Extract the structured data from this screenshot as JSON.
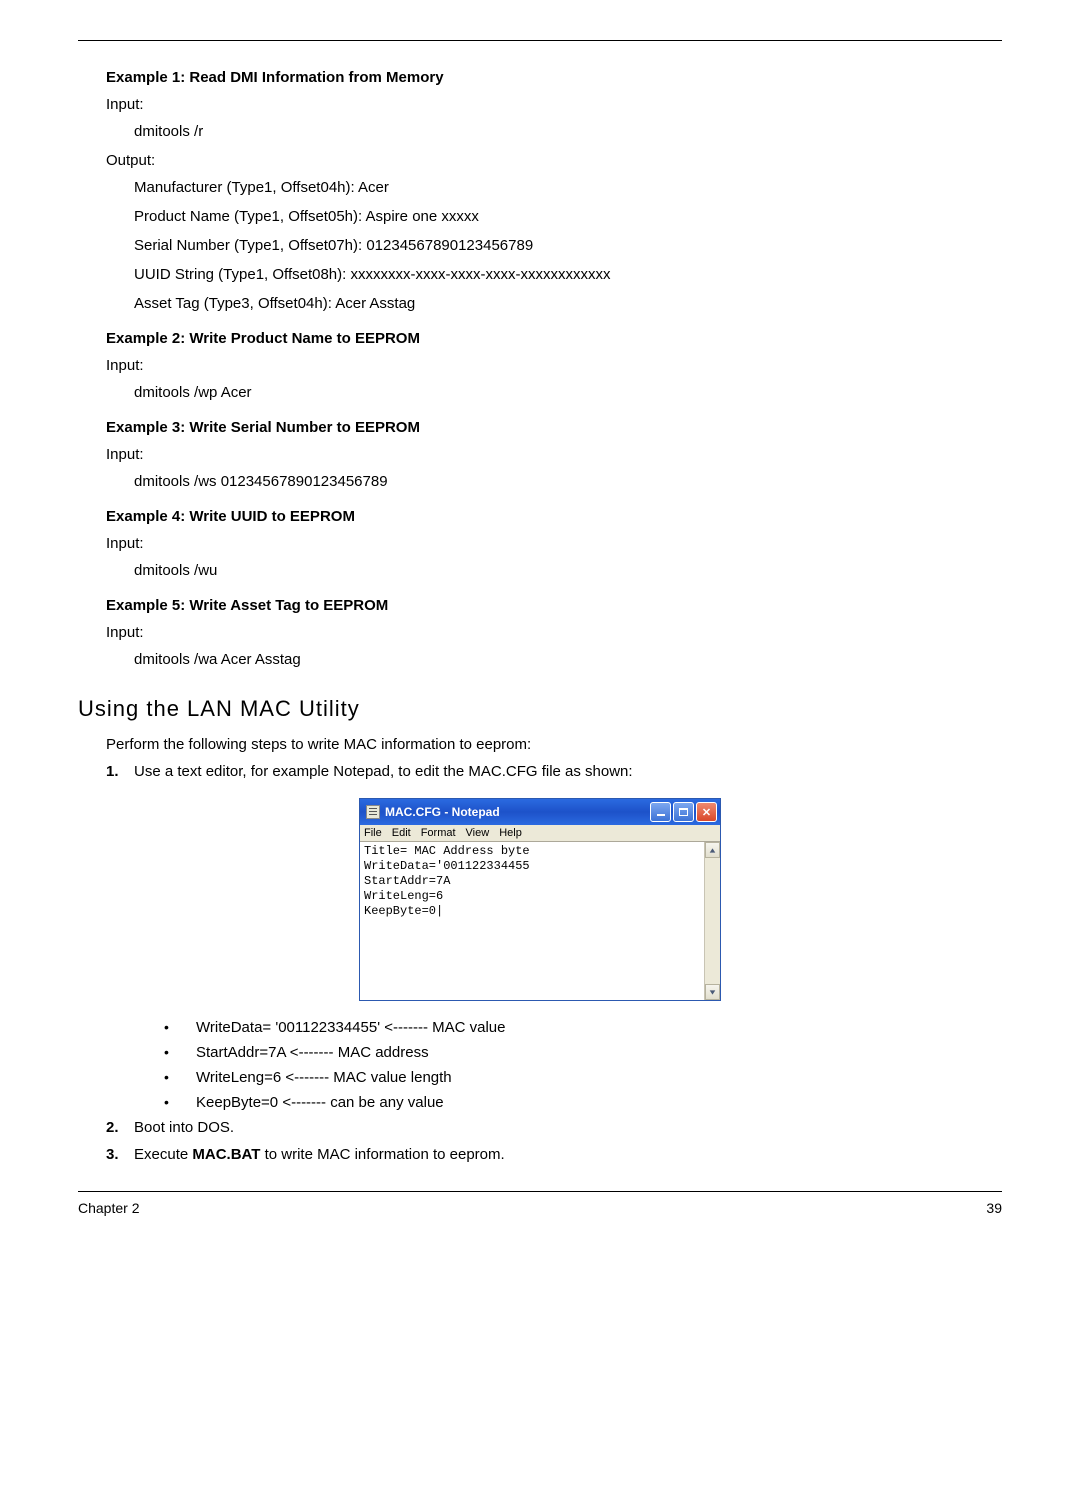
{
  "examples": [
    {
      "heading": "Example 1: Read DMI Information from Memory",
      "input_label": "Input:",
      "input_lines": [
        "dmitools /r"
      ],
      "output_label": "Output:",
      "output_lines": [
        "Manufacturer (Type1, Offset04h): Acer",
        "Product Name (Type1, Offset05h): Aspire one xxxxx",
        "Serial Number (Type1, Offset07h): 01234567890123456789",
        "UUID String (Type1, Offset08h): xxxxxxxx-xxxx-xxxx-xxxx-xxxxxxxxxxxx",
        "Asset Tag (Type3, Offset04h): Acer Asstag"
      ]
    },
    {
      "heading": "Example 2: Write Product Name to EEPROM",
      "input_label": "Input:",
      "input_lines": [
        "dmitools /wp Acer"
      ]
    },
    {
      "heading": "Example 3: Write Serial Number to EEPROM",
      "input_label": "Input:",
      "input_lines": [
        "dmitools /ws 01234567890123456789"
      ]
    },
    {
      "heading": "Example 4: Write UUID to EEPROM",
      "input_label": "Input:",
      "input_lines": [
        "dmitools /wu"
      ]
    },
    {
      "heading": "Example 5: Write Asset Tag to EEPROM",
      "input_label": "Input:",
      "input_lines": [
        "dmitools /wa Acer Asstag"
      ]
    }
  ],
  "section_heading": "Using the LAN MAC Utility",
  "section_intro": "Perform the following steps to write MAC information to eeprom:",
  "step1": {
    "num": "1.",
    "text": "Use a text editor, for example Notepad, to edit the MAC.CFG file as shown:"
  },
  "notepad": {
    "title": "MAC.CFG - Notepad",
    "menu": [
      "File",
      "Edit",
      "Format",
      "View",
      "Help"
    ],
    "content": "Title= MAC Address byte\nWriteData='001122334455\nStartAddr=7A\nWriteLeng=6\nKeepByte=0|"
  },
  "bullets": [
    "WriteData= '001122334455' <------- MAC value",
    "StartAddr=7A <------- MAC address",
    "WriteLeng=6 <------- MAC value length",
    "KeepByte=0 <------- can be any value"
  ],
  "step2": {
    "num": "2.",
    "text": "Boot into DOS."
  },
  "step3": {
    "num": "3.",
    "text_pre": "Execute ",
    "text_bold": "MAC.BAT",
    "text_post": " to write MAC information to eeprom."
  },
  "footer": {
    "left": "Chapter 2",
    "right": "39"
  }
}
